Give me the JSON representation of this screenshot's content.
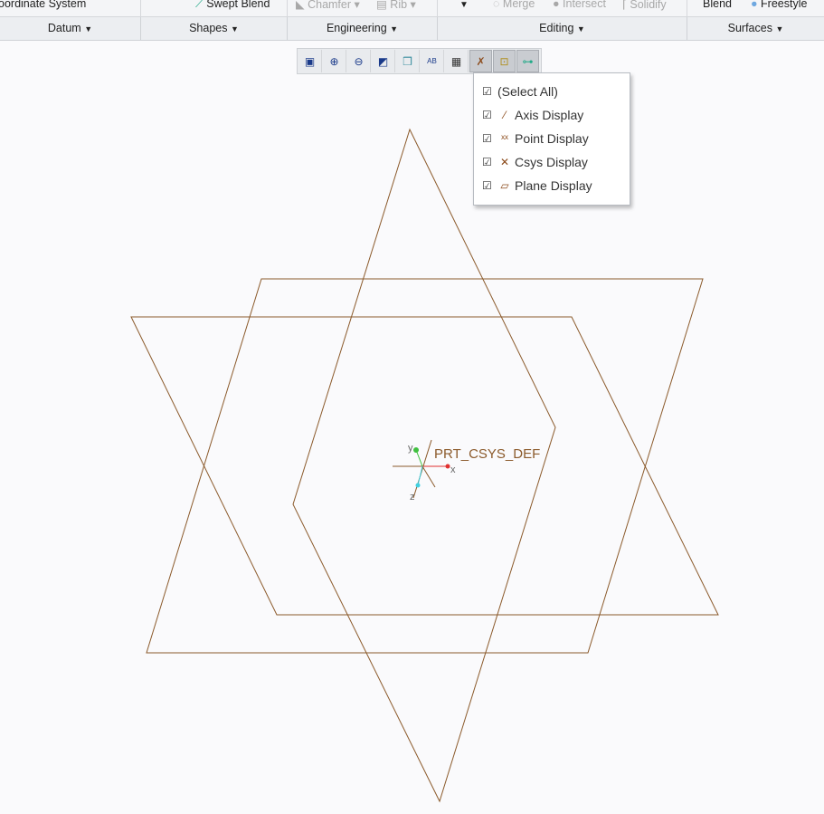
{
  "ribbon_top": {
    "coord": "oordinate System",
    "swept": "Swept Blend",
    "chamfer": "Chamfer",
    "rib": "Rib",
    "merge": "Merge",
    "intersect": "Intersect",
    "solidify": "Solidify",
    "blend": "Blend",
    "freestyle": "Freestyle"
  },
  "groups": [
    "Datum",
    "Shapes",
    "Engineering",
    "Editing",
    "Surfaces"
  ],
  "toolbar": [
    "refit-icon",
    "zoom-in-icon",
    "zoom-out-icon",
    "repaint-icon",
    "display-style-icon",
    "saved-orientations-icon",
    "view-manager-icon",
    "datum-display-filters-icon",
    "annotation-display-icon",
    "spin-center-icon"
  ],
  "menu": {
    "items": [
      {
        "label": "(Select All)",
        "checked": true
      },
      {
        "label": "Axis Display",
        "checked": true
      },
      {
        "label": "Point Display",
        "checked": true
      },
      {
        "label": "Csys Display",
        "checked": true
      },
      {
        "label": "Plane Display",
        "checked": true
      }
    ]
  },
  "viewport": {
    "csys_label": "PRT_CSYS_DEF",
    "x": "x",
    "y": "y",
    "z": "z",
    "plane_color": "#8b5a2b"
  }
}
